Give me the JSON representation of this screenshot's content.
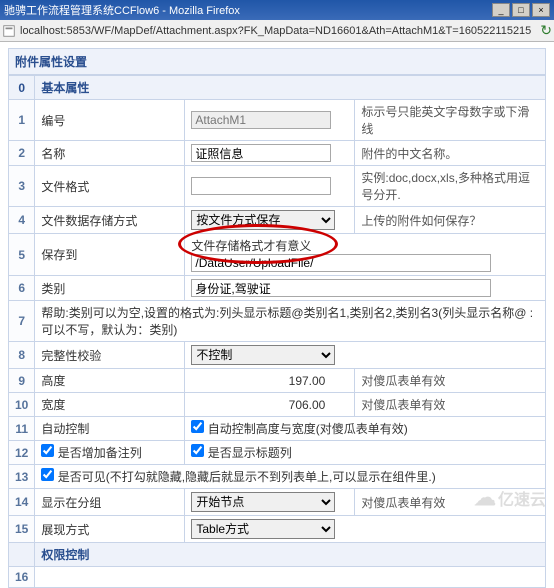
{
  "window": {
    "title": "驰骋工作流程管理系统CCFlow6 - Mozilla Firefox",
    "btn_min": "_",
    "btn_max": "□",
    "btn_close": "×"
  },
  "urlbar": {
    "url": "localhost:5853/WF/MapDef/Attachment.aspx?FK_MapData=ND16601&Ath=AttachM1&T=160522115215"
  },
  "section": {
    "title": "附件属性设置"
  },
  "headers": {
    "basic": "基本属性",
    "perm": "权限控制"
  },
  "rows": {
    "r1": {
      "num": "1",
      "label": "编号",
      "value": "AttachM1",
      "desc": "标示号只能英文字母数字或下滑线"
    },
    "r2": {
      "num": "2",
      "label": "名称",
      "value": "证照信息",
      "desc": "附件的中文名称。"
    },
    "r3": {
      "num": "3",
      "label": "文件格式",
      "value": "",
      "desc": "实例:doc,docx,xls,多种格式用逗号分开."
    },
    "r4": {
      "num": "4",
      "label": "文件数据存储方式",
      "value": "按文件方式保存",
      "desc": "上传的附件如何保存？"
    },
    "r5": {
      "num": "5",
      "label": "保存到",
      "hint": "文件存储格式才有意义",
      "value": "/DataUser/UploadFile/"
    },
    "r6": {
      "num": "6",
      "label": "类别",
      "value": "身份证,驾驶证"
    },
    "r7": {
      "num": "7",
      "label": "帮助:类别可以为空,设置的格式为:列头显示标题@类别名1,类别名2,类别名3(列头显示名称@ :可以不写，默认为：类别)"
    },
    "r8": {
      "num": "8",
      "label": "完整性校验",
      "value": "不控制"
    },
    "r9": {
      "num": "9",
      "label": "高度",
      "value": "197.00",
      "desc": "对傻瓜表单有效"
    },
    "r10": {
      "num": "10",
      "label": "宽度",
      "value": "706.00",
      "desc": "对傻瓜表单有效"
    },
    "r11": {
      "num": "11",
      "label": "自动控制",
      "cb": "自动控制高度与宽度(对傻瓜表单有效)"
    },
    "r12": {
      "num": "12",
      "label": "是否增加备注列",
      "cb": "是否显示标题列"
    },
    "r13": {
      "num": "13",
      "label": "是否可见(不打勾就隐藏,隐藏后就显示不到列表单上,可以显示在组件里.)"
    },
    "r14": {
      "num": "14",
      "label": "显示在分组",
      "value": "开始节点",
      "desc": "对傻瓜表单有效"
    },
    "r15": {
      "num": "15",
      "label": "展现方式",
      "value": "Table方式"
    },
    "r16": {
      "num": "16"
    }
  },
  "watermark": {
    "text": "亿速云"
  }
}
